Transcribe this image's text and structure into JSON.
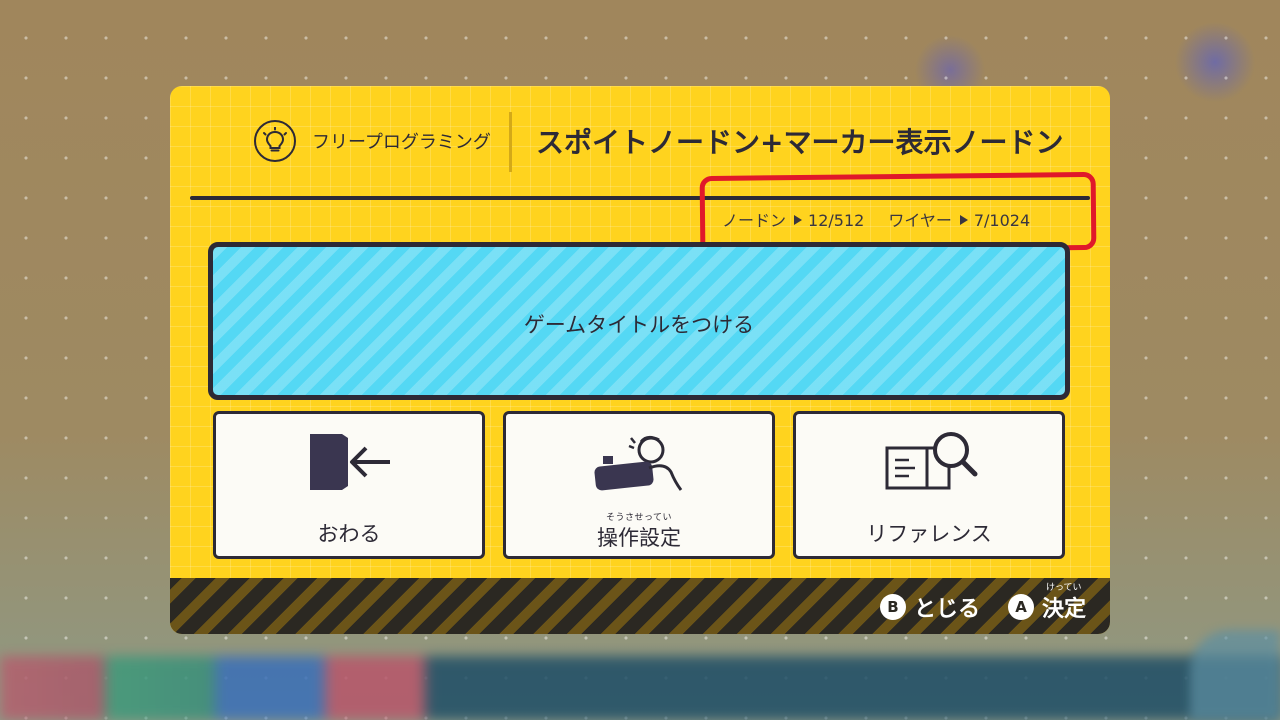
{
  "header": {
    "mode_icon": "lightbulb-icon",
    "mode_label": "フリープログラミング",
    "program_title": "スポイトノードン+マーカー表示ノードン"
  },
  "stats": {
    "nodon_label": "ノードン",
    "nodon_value": "12/512",
    "wire_label": "ワイヤー",
    "wire_value": "7/1024",
    "annotation_color": "#e0182a"
  },
  "main_button": {
    "label": "ゲームタイトルをつける",
    "color": "#54d8f4"
  },
  "cards": [
    {
      "label": "おわる",
      "icon": "exit-door-icon"
    },
    {
      "label": "操作設定",
      "furigana": "そうさせってい",
      "icon": "controller-person-icon"
    },
    {
      "label": "リファレンス",
      "icon": "book-magnifier-icon"
    }
  ],
  "footer": {
    "close_button_glyph": "B",
    "close_label": "とじる",
    "confirm_button_glyph": "A",
    "confirm_label": "決定",
    "confirm_furigana": "けってい"
  },
  "colors": {
    "panel": "#ffd31e",
    "dark": "#2d2a36"
  }
}
